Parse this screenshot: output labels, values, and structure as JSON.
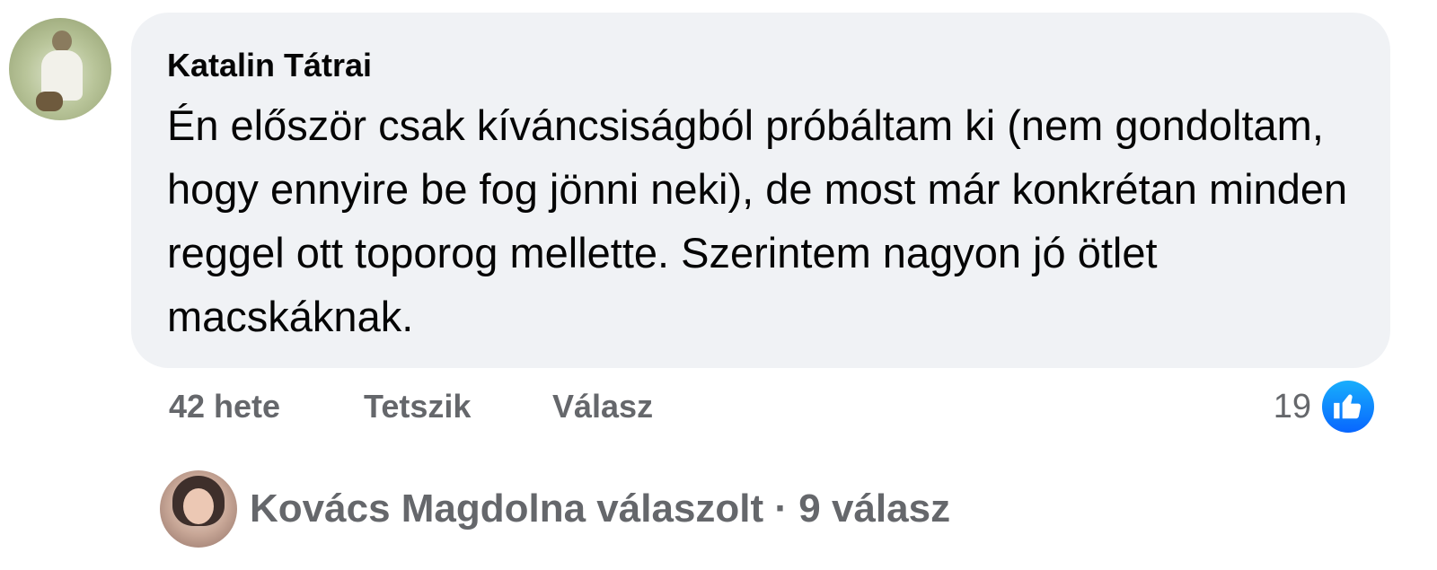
{
  "comment": {
    "author": "Katalin Tátrai",
    "text": "Én először csak kíváncsiságból próbáltam ki (nem gondoltam, hogy ennyire be fog jönni neki), de most már konkrétan minden reggel ott toporog mellette. Szerintem nagyon jó ötlet macskáknak.",
    "time": "42 hete",
    "like_label": "Tetszik",
    "reply_label": "Válasz",
    "reaction_count": "19",
    "reaction_icon": "thumbs-up-icon"
  },
  "replies": {
    "summary": "Kovács Magdolna válaszolt · 9 válasz"
  },
  "colors": {
    "bubble_bg": "#f0f2f5",
    "meta_text": "#65676b",
    "like_blue": "#0866ff"
  }
}
